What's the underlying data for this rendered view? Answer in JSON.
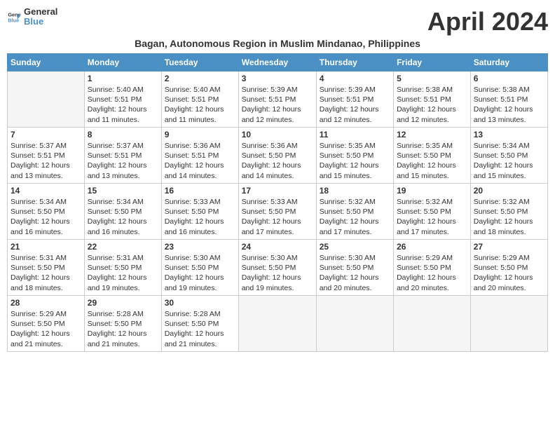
{
  "logo": {
    "line1": "General",
    "line2": "Blue",
    "tagline": "General\nBlue"
  },
  "title": "April 2024",
  "subtitle": "Bagan, Autonomous Region in Muslim Mindanao, Philippines",
  "days_of_week": [
    "Sunday",
    "Monday",
    "Tuesday",
    "Wednesday",
    "Thursday",
    "Friday",
    "Saturday"
  ],
  "weeks": [
    [
      {
        "day": "",
        "info": ""
      },
      {
        "day": "1",
        "info": "Sunrise: 5:40 AM\nSunset: 5:51 PM\nDaylight: 12 hours\nand 11 minutes."
      },
      {
        "day": "2",
        "info": "Sunrise: 5:40 AM\nSunset: 5:51 PM\nDaylight: 12 hours\nand 11 minutes."
      },
      {
        "day": "3",
        "info": "Sunrise: 5:39 AM\nSunset: 5:51 PM\nDaylight: 12 hours\nand 12 minutes."
      },
      {
        "day": "4",
        "info": "Sunrise: 5:39 AM\nSunset: 5:51 PM\nDaylight: 12 hours\nand 12 minutes."
      },
      {
        "day": "5",
        "info": "Sunrise: 5:38 AM\nSunset: 5:51 PM\nDaylight: 12 hours\nand 12 minutes."
      },
      {
        "day": "6",
        "info": "Sunrise: 5:38 AM\nSunset: 5:51 PM\nDaylight: 12 hours\nand 13 minutes."
      }
    ],
    [
      {
        "day": "7",
        "info": "Sunrise: 5:37 AM\nSunset: 5:51 PM\nDaylight: 12 hours\nand 13 minutes."
      },
      {
        "day": "8",
        "info": "Sunrise: 5:37 AM\nSunset: 5:51 PM\nDaylight: 12 hours\nand 13 minutes."
      },
      {
        "day": "9",
        "info": "Sunrise: 5:36 AM\nSunset: 5:51 PM\nDaylight: 12 hours\nand 14 minutes."
      },
      {
        "day": "10",
        "info": "Sunrise: 5:36 AM\nSunset: 5:50 PM\nDaylight: 12 hours\nand 14 minutes."
      },
      {
        "day": "11",
        "info": "Sunrise: 5:35 AM\nSunset: 5:50 PM\nDaylight: 12 hours\nand 15 minutes."
      },
      {
        "day": "12",
        "info": "Sunrise: 5:35 AM\nSunset: 5:50 PM\nDaylight: 12 hours\nand 15 minutes."
      },
      {
        "day": "13",
        "info": "Sunrise: 5:34 AM\nSunset: 5:50 PM\nDaylight: 12 hours\nand 15 minutes."
      }
    ],
    [
      {
        "day": "14",
        "info": "Sunrise: 5:34 AM\nSunset: 5:50 PM\nDaylight: 12 hours\nand 16 minutes."
      },
      {
        "day": "15",
        "info": "Sunrise: 5:34 AM\nSunset: 5:50 PM\nDaylight: 12 hours\nand 16 minutes."
      },
      {
        "day": "16",
        "info": "Sunrise: 5:33 AM\nSunset: 5:50 PM\nDaylight: 12 hours\nand 16 minutes."
      },
      {
        "day": "17",
        "info": "Sunrise: 5:33 AM\nSunset: 5:50 PM\nDaylight: 12 hours\nand 17 minutes."
      },
      {
        "day": "18",
        "info": "Sunrise: 5:32 AM\nSunset: 5:50 PM\nDaylight: 12 hours\nand 17 minutes."
      },
      {
        "day": "19",
        "info": "Sunrise: 5:32 AM\nSunset: 5:50 PM\nDaylight: 12 hours\nand 17 minutes."
      },
      {
        "day": "20",
        "info": "Sunrise: 5:32 AM\nSunset: 5:50 PM\nDaylight: 12 hours\nand 18 minutes."
      }
    ],
    [
      {
        "day": "21",
        "info": "Sunrise: 5:31 AM\nSunset: 5:50 PM\nDaylight: 12 hours\nand 18 minutes."
      },
      {
        "day": "22",
        "info": "Sunrise: 5:31 AM\nSunset: 5:50 PM\nDaylight: 12 hours\nand 19 minutes."
      },
      {
        "day": "23",
        "info": "Sunrise: 5:30 AM\nSunset: 5:50 PM\nDaylight: 12 hours\nand 19 minutes."
      },
      {
        "day": "24",
        "info": "Sunrise: 5:30 AM\nSunset: 5:50 PM\nDaylight: 12 hours\nand 19 minutes."
      },
      {
        "day": "25",
        "info": "Sunrise: 5:30 AM\nSunset: 5:50 PM\nDaylight: 12 hours\nand 20 minutes."
      },
      {
        "day": "26",
        "info": "Sunrise: 5:29 AM\nSunset: 5:50 PM\nDaylight: 12 hours\nand 20 minutes."
      },
      {
        "day": "27",
        "info": "Sunrise: 5:29 AM\nSunset: 5:50 PM\nDaylight: 12 hours\nand 20 minutes."
      }
    ],
    [
      {
        "day": "28",
        "info": "Sunrise: 5:29 AM\nSunset: 5:50 PM\nDaylight: 12 hours\nand 21 minutes."
      },
      {
        "day": "29",
        "info": "Sunrise: 5:28 AM\nSunset: 5:50 PM\nDaylight: 12 hours\nand 21 minutes."
      },
      {
        "day": "30",
        "info": "Sunrise: 5:28 AM\nSunset: 5:50 PM\nDaylight: 12 hours\nand 21 minutes."
      },
      {
        "day": "",
        "info": ""
      },
      {
        "day": "",
        "info": ""
      },
      {
        "day": "",
        "info": ""
      },
      {
        "day": "",
        "info": ""
      }
    ]
  ]
}
